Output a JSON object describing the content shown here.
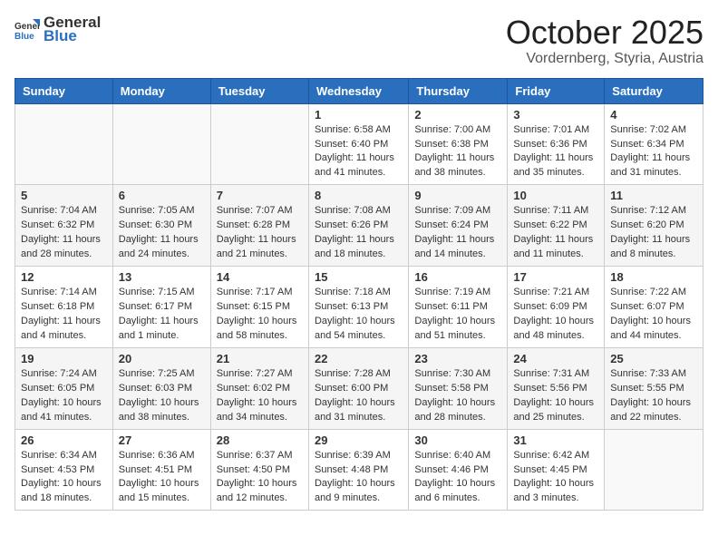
{
  "header": {
    "logo_general": "General",
    "logo_blue": "Blue",
    "month_title": "October 2025",
    "location": "Vordernberg, Styria, Austria"
  },
  "weekdays": [
    "Sunday",
    "Monday",
    "Tuesday",
    "Wednesday",
    "Thursday",
    "Friday",
    "Saturday"
  ],
  "weeks": [
    [
      {
        "day": "",
        "sunrise": "",
        "sunset": "",
        "daylight": ""
      },
      {
        "day": "",
        "sunrise": "",
        "sunset": "",
        "daylight": ""
      },
      {
        "day": "",
        "sunrise": "",
        "sunset": "",
        "daylight": ""
      },
      {
        "day": "1",
        "sunrise": "Sunrise: 6:58 AM",
        "sunset": "Sunset: 6:40 PM",
        "daylight": "Daylight: 11 hours and 41 minutes."
      },
      {
        "day": "2",
        "sunrise": "Sunrise: 7:00 AM",
        "sunset": "Sunset: 6:38 PM",
        "daylight": "Daylight: 11 hours and 38 minutes."
      },
      {
        "day": "3",
        "sunrise": "Sunrise: 7:01 AM",
        "sunset": "Sunset: 6:36 PM",
        "daylight": "Daylight: 11 hours and 35 minutes."
      },
      {
        "day": "4",
        "sunrise": "Sunrise: 7:02 AM",
        "sunset": "Sunset: 6:34 PM",
        "daylight": "Daylight: 11 hours and 31 minutes."
      }
    ],
    [
      {
        "day": "5",
        "sunrise": "Sunrise: 7:04 AM",
        "sunset": "Sunset: 6:32 PM",
        "daylight": "Daylight: 11 hours and 28 minutes."
      },
      {
        "day": "6",
        "sunrise": "Sunrise: 7:05 AM",
        "sunset": "Sunset: 6:30 PM",
        "daylight": "Daylight: 11 hours and 24 minutes."
      },
      {
        "day": "7",
        "sunrise": "Sunrise: 7:07 AM",
        "sunset": "Sunset: 6:28 PM",
        "daylight": "Daylight: 11 hours and 21 minutes."
      },
      {
        "day": "8",
        "sunrise": "Sunrise: 7:08 AM",
        "sunset": "Sunset: 6:26 PM",
        "daylight": "Daylight: 11 hours and 18 minutes."
      },
      {
        "day": "9",
        "sunrise": "Sunrise: 7:09 AM",
        "sunset": "Sunset: 6:24 PM",
        "daylight": "Daylight: 11 hours and 14 minutes."
      },
      {
        "day": "10",
        "sunrise": "Sunrise: 7:11 AM",
        "sunset": "Sunset: 6:22 PM",
        "daylight": "Daylight: 11 hours and 11 minutes."
      },
      {
        "day": "11",
        "sunrise": "Sunrise: 7:12 AM",
        "sunset": "Sunset: 6:20 PM",
        "daylight": "Daylight: 11 hours and 8 minutes."
      }
    ],
    [
      {
        "day": "12",
        "sunrise": "Sunrise: 7:14 AM",
        "sunset": "Sunset: 6:18 PM",
        "daylight": "Daylight: 11 hours and 4 minutes."
      },
      {
        "day": "13",
        "sunrise": "Sunrise: 7:15 AM",
        "sunset": "Sunset: 6:17 PM",
        "daylight": "Daylight: 11 hours and 1 minute."
      },
      {
        "day": "14",
        "sunrise": "Sunrise: 7:17 AM",
        "sunset": "Sunset: 6:15 PM",
        "daylight": "Daylight: 10 hours and 58 minutes."
      },
      {
        "day": "15",
        "sunrise": "Sunrise: 7:18 AM",
        "sunset": "Sunset: 6:13 PM",
        "daylight": "Daylight: 10 hours and 54 minutes."
      },
      {
        "day": "16",
        "sunrise": "Sunrise: 7:19 AM",
        "sunset": "Sunset: 6:11 PM",
        "daylight": "Daylight: 10 hours and 51 minutes."
      },
      {
        "day": "17",
        "sunrise": "Sunrise: 7:21 AM",
        "sunset": "Sunset: 6:09 PM",
        "daylight": "Daylight: 10 hours and 48 minutes."
      },
      {
        "day": "18",
        "sunrise": "Sunrise: 7:22 AM",
        "sunset": "Sunset: 6:07 PM",
        "daylight": "Daylight: 10 hours and 44 minutes."
      }
    ],
    [
      {
        "day": "19",
        "sunrise": "Sunrise: 7:24 AM",
        "sunset": "Sunset: 6:05 PM",
        "daylight": "Daylight: 10 hours and 41 minutes."
      },
      {
        "day": "20",
        "sunrise": "Sunrise: 7:25 AM",
        "sunset": "Sunset: 6:03 PM",
        "daylight": "Daylight: 10 hours and 38 minutes."
      },
      {
        "day": "21",
        "sunrise": "Sunrise: 7:27 AM",
        "sunset": "Sunset: 6:02 PM",
        "daylight": "Daylight: 10 hours and 34 minutes."
      },
      {
        "day": "22",
        "sunrise": "Sunrise: 7:28 AM",
        "sunset": "Sunset: 6:00 PM",
        "daylight": "Daylight: 10 hours and 31 minutes."
      },
      {
        "day": "23",
        "sunrise": "Sunrise: 7:30 AM",
        "sunset": "Sunset: 5:58 PM",
        "daylight": "Daylight: 10 hours and 28 minutes."
      },
      {
        "day": "24",
        "sunrise": "Sunrise: 7:31 AM",
        "sunset": "Sunset: 5:56 PM",
        "daylight": "Daylight: 10 hours and 25 minutes."
      },
      {
        "day": "25",
        "sunrise": "Sunrise: 7:33 AM",
        "sunset": "Sunset: 5:55 PM",
        "daylight": "Daylight: 10 hours and 22 minutes."
      }
    ],
    [
      {
        "day": "26",
        "sunrise": "Sunrise: 6:34 AM",
        "sunset": "Sunset: 4:53 PM",
        "daylight": "Daylight: 10 hours and 18 minutes."
      },
      {
        "day": "27",
        "sunrise": "Sunrise: 6:36 AM",
        "sunset": "Sunset: 4:51 PM",
        "daylight": "Daylight: 10 hours and 15 minutes."
      },
      {
        "day": "28",
        "sunrise": "Sunrise: 6:37 AM",
        "sunset": "Sunset: 4:50 PM",
        "daylight": "Daylight: 10 hours and 12 minutes."
      },
      {
        "day": "29",
        "sunrise": "Sunrise: 6:39 AM",
        "sunset": "Sunset: 4:48 PM",
        "daylight": "Daylight: 10 hours and 9 minutes."
      },
      {
        "day": "30",
        "sunrise": "Sunrise: 6:40 AM",
        "sunset": "Sunset: 4:46 PM",
        "daylight": "Daylight: 10 hours and 6 minutes."
      },
      {
        "day": "31",
        "sunrise": "Sunrise: 6:42 AM",
        "sunset": "Sunset: 4:45 PM",
        "daylight": "Daylight: 10 hours and 3 minutes."
      },
      {
        "day": "",
        "sunrise": "",
        "sunset": "",
        "daylight": ""
      }
    ]
  ]
}
